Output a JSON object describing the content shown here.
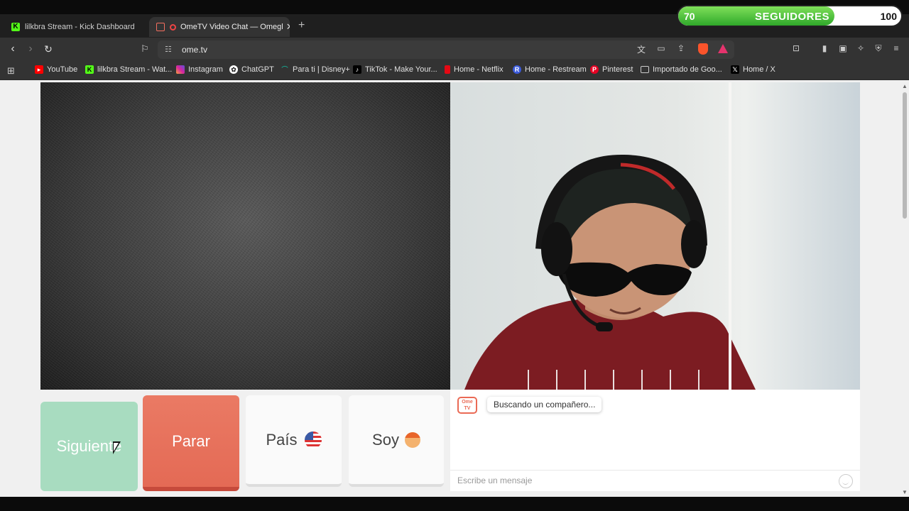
{
  "tabs": [
    {
      "title": "lilkbra Stream - Kick Dashboard",
      "active": false
    },
    {
      "title": "OmeTV Video Chat — Omegl",
      "active": true
    }
  ],
  "url": "ome.tv",
  "bookmarks": [
    {
      "label": "YouTube",
      "icon": "youtube-icon",
      "color": "#ff0000"
    },
    {
      "label": "lilkbra Stream - Wat...",
      "icon": "kick-icon",
      "color": "#53fc18"
    },
    {
      "label": "Instagram",
      "icon": "instagram-icon",
      "color": "#d6249f"
    },
    {
      "label": "ChatGPT",
      "icon": "chatgpt-icon",
      "color": "#ffffff"
    },
    {
      "label": "Para ti | Disney+",
      "icon": "disney-icon",
      "color": "#1a7f6a"
    },
    {
      "label": "TikTok - Make Your...",
      "icon": "tiktok-icon",
      "color": "#000000"
    },
    {
      "label": "Home - Netflix",
      "icon": "netflix-icon",
      "color": "#e50914"
    },
    {
      "label": "Home - Restream",
      "icon": "restream-icon",
      "color": "#3b5bdb"
    },
    {
      "label": "Pinterest",
      "icon": "pinterest-icon",
      "color": "#e60023"
    },
    {
      "label": "Importado de Goo...",
      "icon": "folder-icon",
      "color": "#cccccc"
    },
    {
      "label": "Home / X",
      "icon": "x-icon",
      "color": "#000000"
    }
  ],
  "followers_overlay": {
    "current": "70",
    "label": "SEGUIDORES",
    "goal": "100",
    "progress": 0.7
  },
  "controls": {
    "next": "Siguiente",
    "stop": "Parar",
    "country": "País",
    "gender": "Soy"
  },
  "chat": {
    "logo_line1": "Ome",
    "logo_line2": "TV",
    "status": "Buscando un compañero...",
    "input_placeholder": "Escribe un mensaje"
  }
}
